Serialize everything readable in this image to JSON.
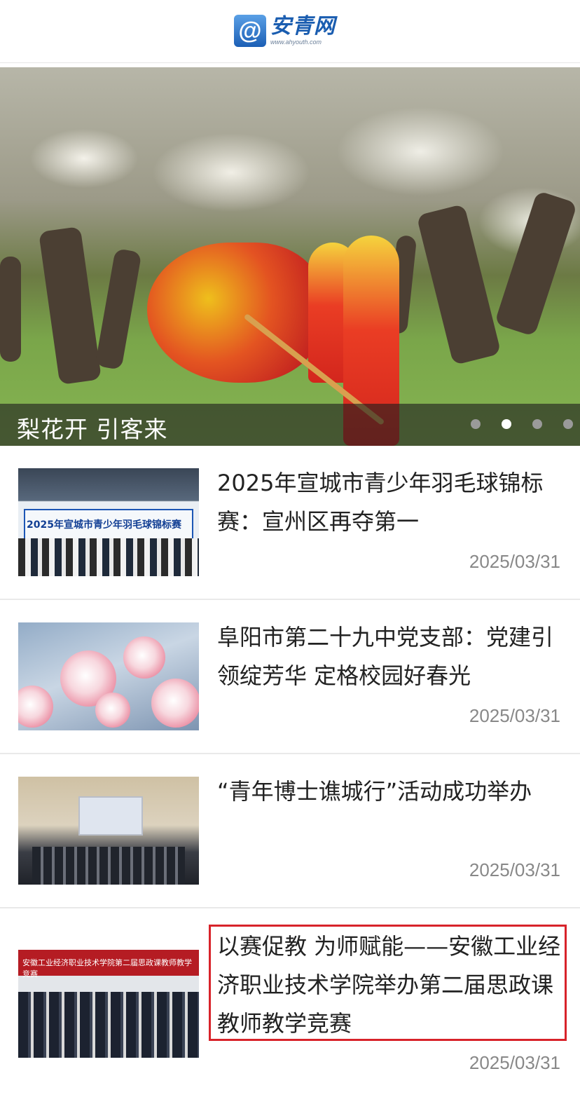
{
  "header": {
    "logo_symbol": "@",
    "logo_name": "安青网",
    "logo_url": "www.ahyouth.com"
  },
  "banner": {
    "caption": "梨花开 引客来",
    "slides": 4,
    "active_slide": 2
  },
  "articles": [
    {
      "title": "2025年宣城市青少年羽毛球锦标赛：宣州区再夺第一",
      "date": "2025/03/31",
      "thumb_sign": "2025年宣城市青少年羽毛球锦标赛"
    },
    {
      "title": "阜阳市第二十九中党支部：党建引领绽芳华 定格校园好春光",
      "date": "2025/03/31"
    },
    {
      "title": "“青年博士谯城行”活动成功举办",
      "date": "2025/03/31"
    },
    {
      "title": "以赛促教 为师赋能——安徽工业经济职业技术学院举办第二届思政课教师教学竞赛",
      "date": "2025/03/31",
      "thumb_sign": "安徽工业经济职业技术学院第二届思政课教师教学竞赛"
    }
  ],
  "colors": {
    "brand_blue": "#1a5db0",
    "highlight_red": "#d8232a"
  }
}
